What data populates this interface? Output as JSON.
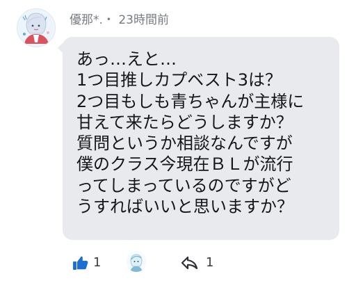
{
  "comment": {
    "author": "優那*.・",
    "timestamp": "23時間前",
    "message": "あっ…えと…\n1つ目推しカプベスト3は？\n2つ目もしも青ちゃんが主様に\n甘えて来たらどうしますか？\n質問というか相談なんですが\n僕のクラス今現在ＢＬが流行\nってしまっているのですがど\nうすればいいと思いますか？",
    "likes": "1",
    "replies": "1"
  },
  "icons": {
    "like": "thumbs-up-icon",
    "reply": "reply-arrow-icon",
    "avatar": "avatar",
    "reactor": "reactor-avatar"
  },
  "colors": {
    "accent": "#1f6ed4",
    "bubble": "#e9eaed",
    "meta_text": "#777c84",
    "body_text": "#151618"
  }
}
